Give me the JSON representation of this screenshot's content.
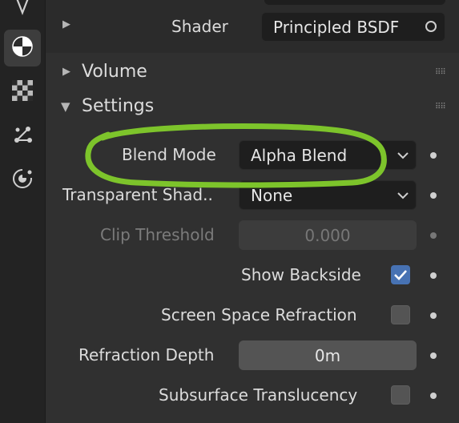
{
  "shader_row": {
    "label": "Shader",
    "value": "Principled BSDF"
  },
  "volume": {
    "title": "Volume"
  },
  "settings": {
    "title": "Settings",
    "blend_mode": {
      "label": "Blend Mode",
      "value": "Alpha Blend"
    },
    "transparent_shadow": {
      "label": "Transparent Shad..",
      "value": "None"
    },
    "clip_threshold": {
      "label": "Clip Threshold",
      "value": "0.000"
    },
    "show_backside": {
      "label": "Show Backside",
      "checked": true
    },
    "screen_space_refraction": {
      "label": "Screen Space Refraction",
      "checked": false
    },
    "refraction_depth": {
      "label": "Refraction Depth",
      "value": "0m"
    },
    "subsurface_translucency": {
      "label": "Subsurface Translucency",
      "checked": false
    }
  },
  "tabs": [
    "object-data-icon",
    "material-icon",
    "texture-icon",
    "particles-icon",
    "physics-icon"
  ],
  "colors": {
    "accent": "#4772b3",
    "annotation": "#7dc42b",
    "panel": "#303030"
  }
}
